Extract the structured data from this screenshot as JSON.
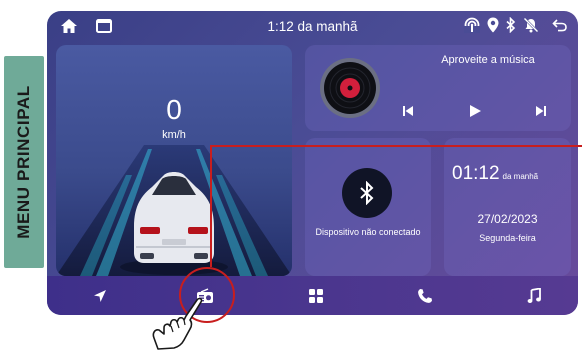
{
  "side_label": "MENU PRINCIPAL",
  "statusbar": {
    "time": "1:12 da manhã",
    "icons": [
      "home-icon",
      "window-icon",
      "hotspot-icon",
      "location-icon",
      "bluetooth-icon",
      "mute-icon",
      "back-icon"
    ]
  },
  "speed": {
    "value": "0",
    "unit": "km/h"
  },
  "music": {
    "title": "Aproveite a música",
    "controls": [
      "previous-icon",
      "play-icon",
      "next-icon"
    ]
  },
  "bluetooth": {
    "status": "Dispositivo não conectado"
  },
  "clock": {
    "time": "01:12",
    "period": "da manhã",
    "date": "27/02/2023",
    "weekday": "Segunda-feira"
  },
  "nav": [
    "navigation-icon",
    "radio-icon",
    "apps-icon",
    "phone-icon",
    "music-icon"
  ],
  "colors": {
    "accent_red": "#c81e1e",
    "side_label_bg": "#6faa98",
    "screen_bg": "#4a4c95"
  }
}
